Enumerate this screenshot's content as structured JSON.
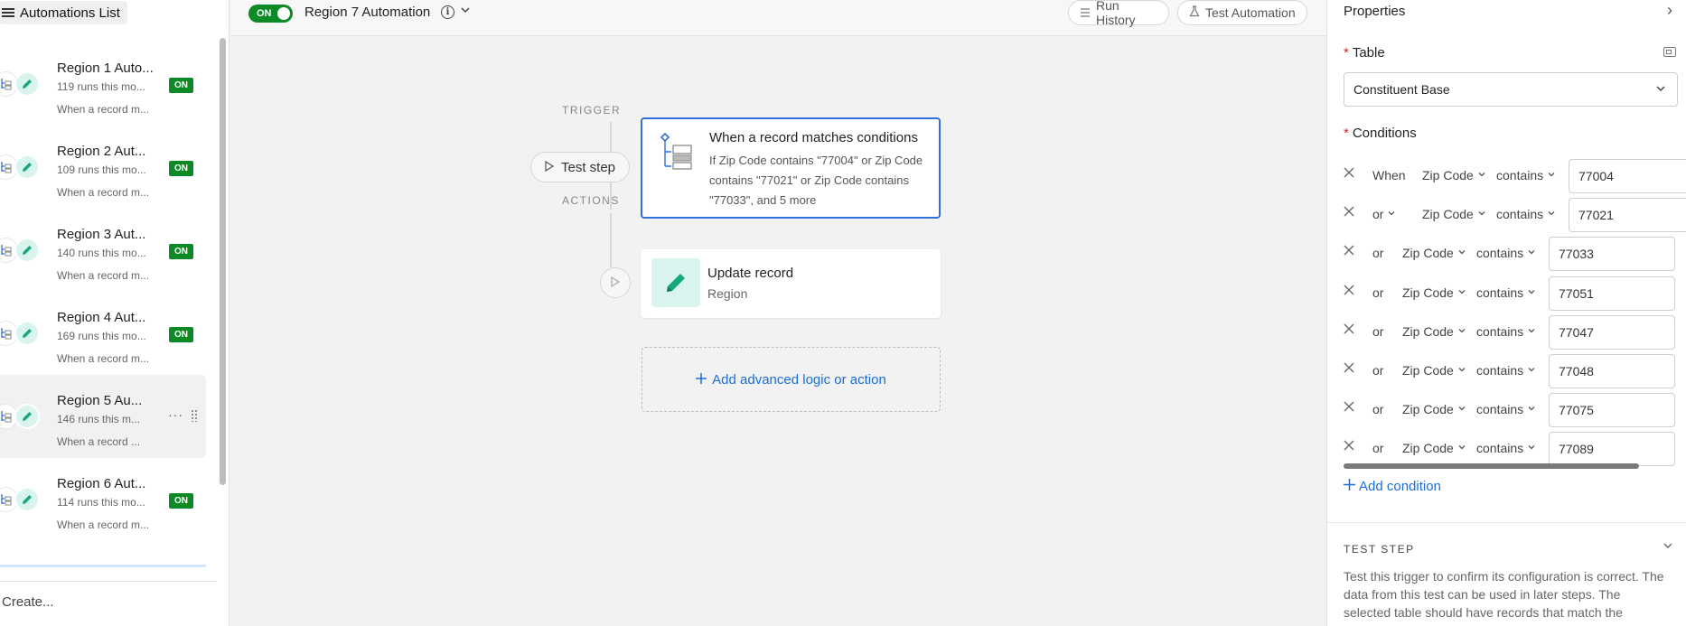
{
  "sidebar": {
    "header_label": "Automations List",
    "items": [
      {
        "name": "Region 1 Auto...",
        "runs": "119 runs this mo...",
        "trigger": "When a record m...",
        "status": "ON"
      },
      {
        "name": "Region 2 Aut...",
        "runs": "109 runs this mo...",
        "trigger": "When a record m...",
        "status": "ON"
      },
      {
        "name": "Region 3 Aut...",
        "runs": "140 runs this mo...",
        "trigger": "When a record m...",
        "status": "ON"
      },
      {
        "name": "Region 4 Aut...",
        "runs": "169 runs this mo...",
        "trigger": "When a record m...",
        "status": "ON"
      },
      {
        "name": "Region 5 Au...",
        "runs": "146 runs this m...",
        "trigger": "When a record ...",
        "more": "···"
      },
      {
        "name": "Region 6 Aut...",
        "runs": "114 runs this mo...",
        "trigger": "When a record m...",
        "status": "ON"
      }
    ],
    "create_label": "Create..."
  },
  "topbar": {
    "toggle_label": "ON",
    "title": "Region 7 Automation",
    "info_glyph": "i",
    "chevron": "⌄",
    "run_history_label": "Run History",
    "test_automation_label": "Test Automation"
  },
  "canvas": {
    "trigger_section": "TRIGGER",
    "actions_section": "ACTIONS",
    "test_step_label": "Test step",
    "trigger_card": {
      "title": "When a record matches conditions",
      "description": "If Zip Code contains \"77004\" or Zip Code contains \"77021\" or Zip Code contains \"77033\", and 5 more"
    },
    "action_card": {
      "title": "Update record",
      "subtitle": "Region"
    },
    "add_logic_label": "Add advanced logic or action"
  },
  "properties": {
    "title": "Properties",
    "close_glyph": "›",
    "table_label": "Table",
    "table_value": "Constituent Base",
    "conditions_label": "Conditions",
    "conditions": [
      {
        "joiner": "When",
        "field": "Zip Code",
        "op": "contains",
        "value": "77004"
      },
      {
        "joiner": "or",
        "field": "Zip Code",
        "op": "contains",
        "value": "77021",
        "joiner_dropdown": true
      },
      {
        "joiner": "or",
        "field": "Zip Code",
        "op": "contains",
        "value": "77033"
      },
      {
        "joiner": "or",
        "field": "Zip Code",
        "op": "contains",
        "value": "77051"
      },
      {
        "joiner": "or",
        "field": "Zip Code",
        "op": "contains",
        "value": "77047"
      },
      {
        "joiner": "or",
        "field": "Zip Code",
        "op": "contains",
        "value": "77048"
      },
      {
        "joiner": "or",
        "field": "Zip Code",
        "op": "contains",
        "value": "77075"
      },
      {
        "joiner": "or",
        "field": "Zip Code",
        "op": "contains",
        "value": "77089"
      }
    ],
    "add_condition_label": "Add condition",
    "test_step_heading": "TEST STEP",
    "test_step_description": "Test this trigger to confirm its configuration is correct. The data from this test can be used in later steps. The selected table should have records that match the configured conditions."
  },
  "colors": {
    "accent_blue": "#2f6fde",
    "link_blue": "#1a6ed8",
    "status_green": "#0b8a25",
    "action_teal_bg": "#d9f4ee",
    "required_red": "#c62828"
  },
  "icons": {
    "menu": "hamburger-icon",
    "trigger": "record-match-icon",
    "action": "pencil-icon",
    "run": "play-icon",
    "run_history": "list-icon",
    "test_automation": "flask-icon",
    "add": "plus-icon",
    "remove": "close-icon",
    "expand": "expand-panel-icon"
  }
}
